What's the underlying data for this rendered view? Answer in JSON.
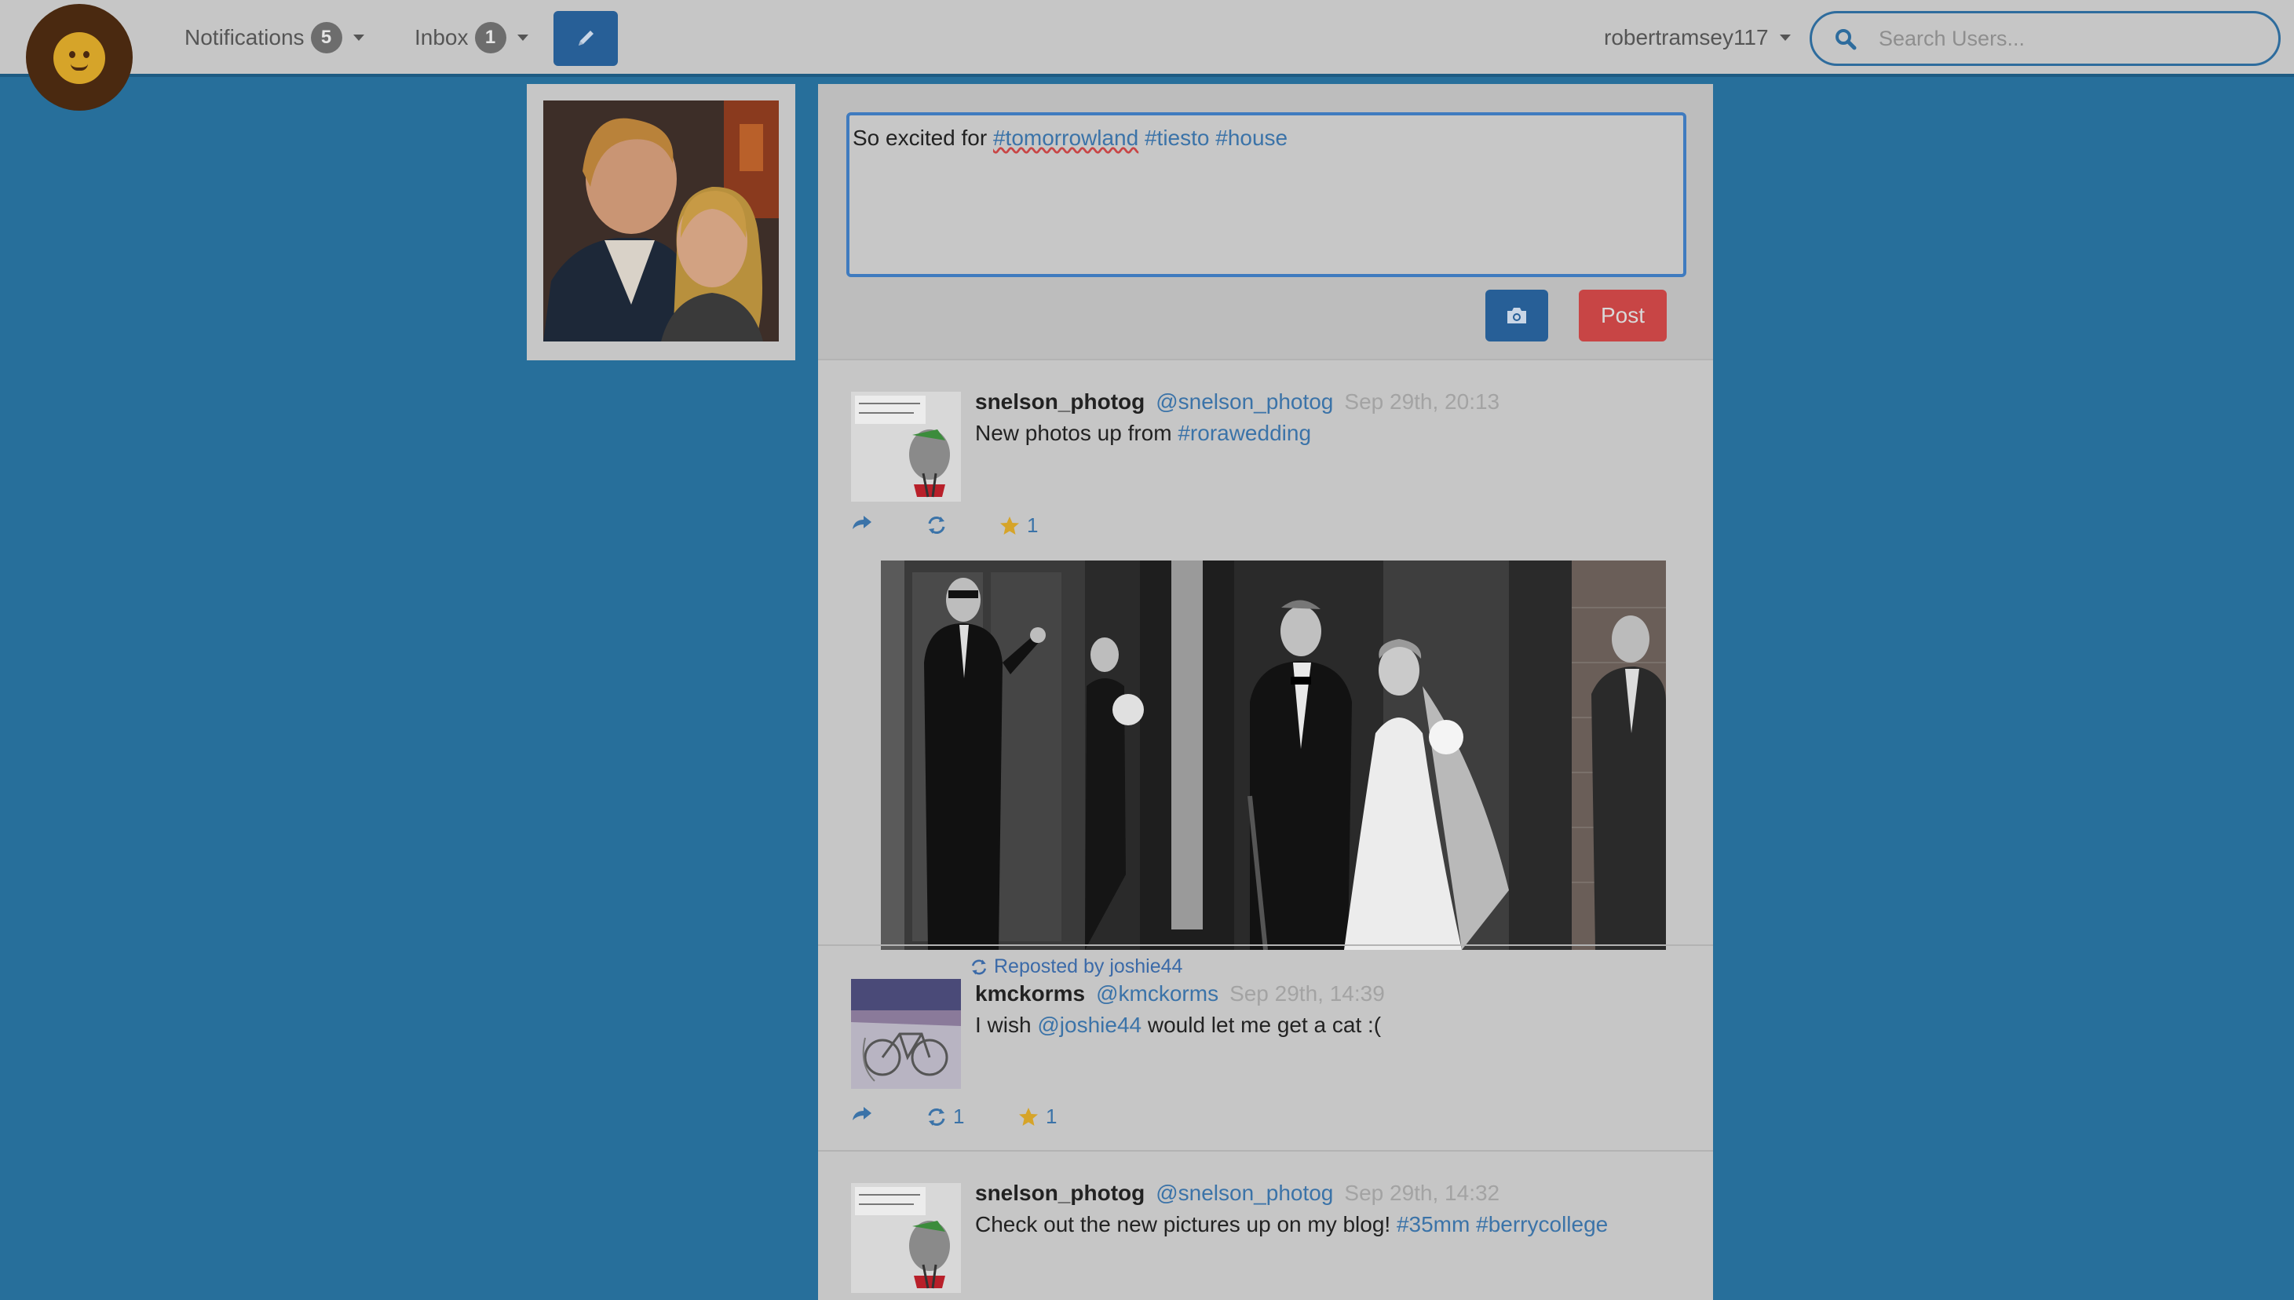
{
  "navbar": {
    "notifications_label": "Notifications",
    "notifications_count": "5",
    "inbox_label": "Inbox",
    "inbox_count": "1",
    "username": "robertramsey117",
    "search_placeholder": "Search Users..."
  },
  "composer": {
    "text_prefix": "So excited for ",
    "tags": [
      "#tomorrowland",
      "#tiesto",
      "#house"
    ],
    "post_label": "Post"
  },
  "posts": [
    {
      "username": "snelson_photog",
      "handle": "@snelson_photog",
      "time": "Sep 29th, 20:13",
      "text": "New photos up from ",
      "tags": [
        "#rorawedding"
      ],
      "repost_count": "",
      "star_count": "1"
    },
    {
      "repost_note": "Reposted by joshie44",
      "username": "kmckorms",
      "handle": "@kmckorms",
      "time": "Sep 29th, 14:39",
      "text_before": "I wish ",
      "mention": "@joshie44",
      "text_after": " would let me get a cat :(",
      "repost_count": "1",
      "star_count": "1"
    },
    {
      "username": "snelson_photog",
      "handle": "@snelson_photog",
      "time": "Sep 29th, 14:32",
      "text": "Check out the new pictures up on my blog! ",
      "tags": [
        "#35mm",
        "#berrycollege"
      ]
    }
  ],
  "colors": {
    "background": "#276f9b",
    "navbar": "#c6c6c6",
    "primary_button": "#275f97",
    "post_button": "#c84545",
    "link": "#3b73a8",
    "star": "#d6a429"
  }
}
